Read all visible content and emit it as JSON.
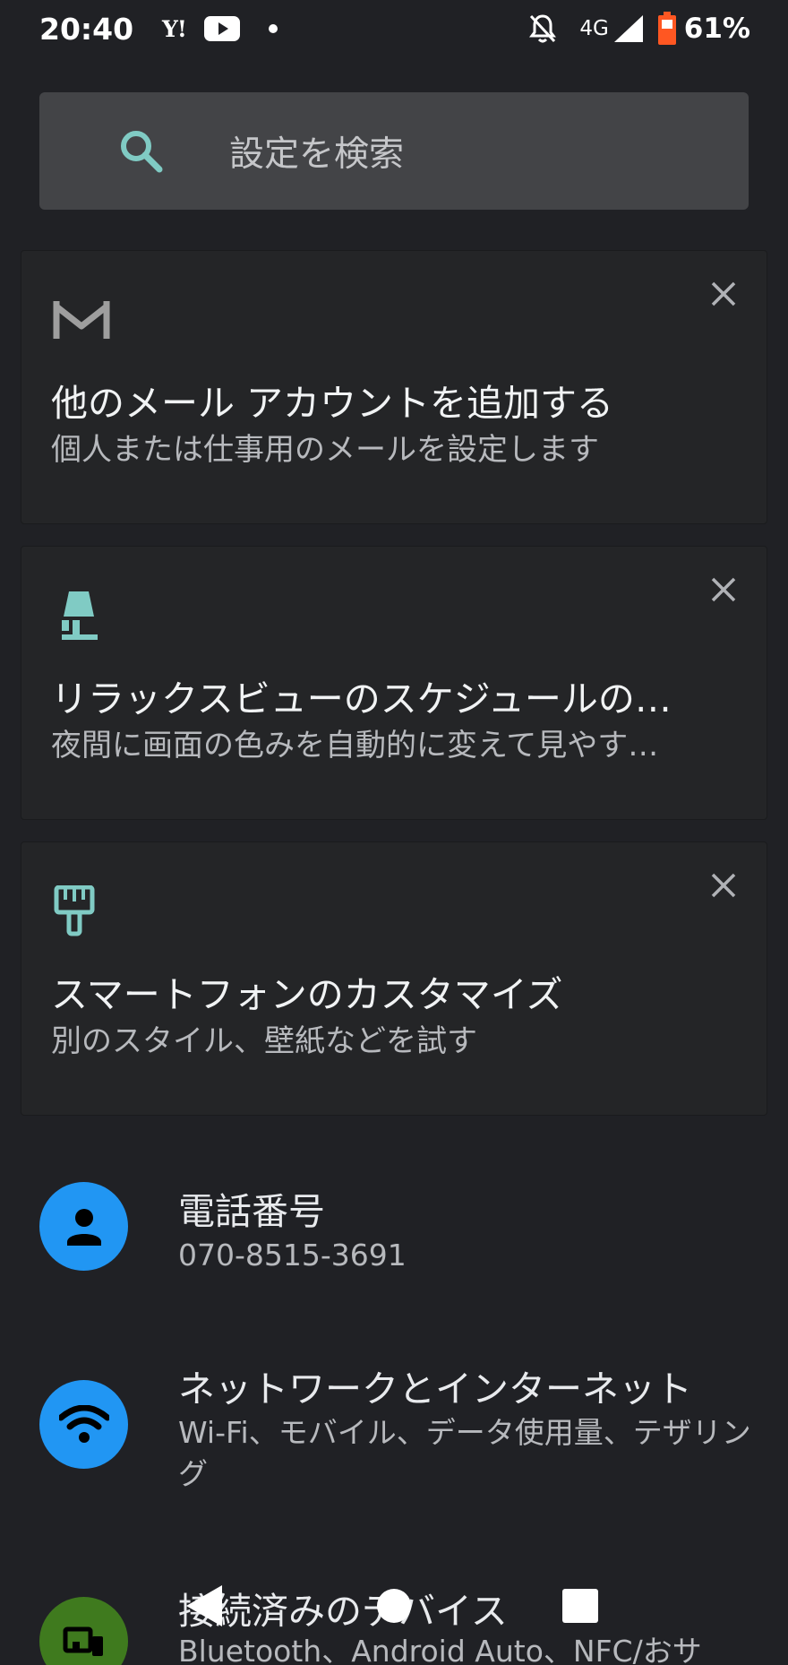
{
  "status_bar": {
    "time": "20:40",
    "yahoo": "Y!",
    "network": "4G",
    "battery": "61%"
  },
  "search": {
    "placeholder": "設定を検索"
  },
  "suggestions": [
    {
      "icon": "gmail-icon",
      "title": "他のメール アカウントを追加する",
      "subtitle": "個人または仕事用のメールを設定します"
    },
    {
      "icon": "lamp-icon",
      "title": "リラックスビューのスケジュールの…",
      "subtitle": "夜間に画面の色みを自動的に変えて見やす…"
    },
    {
      "icon": "paintbrush-icon",
      "title": "スマートフォンのカスタマイズ",
      "subtitle": "別のスタイル、壁紙などを試す"
    }
  ],
  "settings": [
    {
      "icon": "person-icon",
      "title": "電話番号",
      "subtitle": "070-8515-3691"
    },
    {
      "icon": "wifi-icon",
      "title": "ネットワークとインターネット",
      "subtitle": "Wi-Fi、モバイル、データ使用量、テザリング"
    },
    {
      "icon": "devices-icon",
      "title": "接続済みのデバイス",
      "subtitle": "Bluetooth、Android Auto、NFC/おサ"
    }
  ],
  "colors": {
    "background": "#202125",
    "accent_teal": "#80cbc4",
    "icon_blue": "#2196f3",
    "icon_green": "#3f7a1e",
    "battery_orange": "#ff5722"
  }
}
